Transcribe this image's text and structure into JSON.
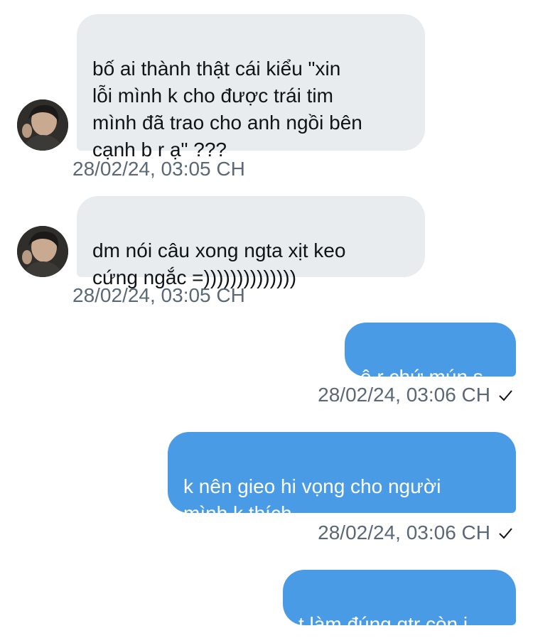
{
  "messages": [
    {
      "direction": "in",
      "text": "bố ai thành thật cái kiểu \"xin\nlỗi mình k cho được trái tim\nmình đã trao cho anh ngồi bên\ncạnh b r ạ\" ???",
      "time": "28/02/24, 03:05 CH"
    },
    {
      "direction": "in",
      "text": "dm nói câu xong ngta xịt keo\ncứng ngắc =))))))))))))))",
      "time": "28/02/24, 03:05 CH"
    },
    {
      "direction": "out",
      "text": "ê r chứ mún s",
      "time": "28/02/24, 03:06 CH",
      "status_icon": "check-icon"
    },
    {
      "direction": "out",
      "text": "k nên gieo hi vọng cho người\nmình k thích",
      "time": "28/02/24, 03:06 CH",
      "status_icon": "check-icon"
    },
    {
      "direction": "out",
      "text": "t làm đúng qtr còn j"
    }
  ],
  "colors": {
    "incoming_bubble": "#e9ecef",
    "outgoing_bubble": "#4a9be6",
    "timestamp": "#5b6875"
  }
}
